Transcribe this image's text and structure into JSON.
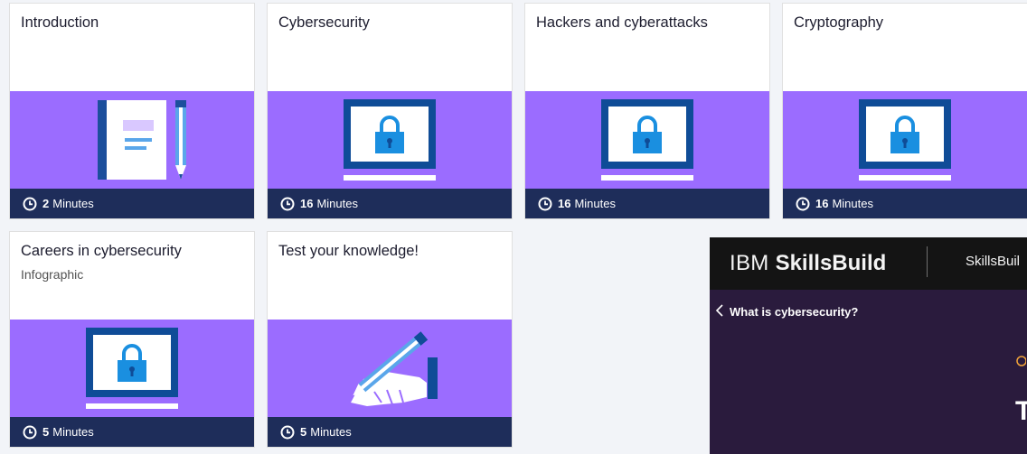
{
  "cards": [
    {
      "title": "Introduction",
      "subtitle": "",
      "duration": "2",
      "unit": "Minutes",
      "art": "notebook-illustration"
    },
    {
      "title": "Cybersecurity",
      "subtitle": "",
      "duration": "16",
      "unit": "Minutes",
      "art": "laptop-lock-illustration"
    },
    {
      "title": "Hackers and cyberattacks",
      "subtitle": "",
      "duration": "16",
      "unit": "Minutes",
      "art": "laptop-lock-illustration"
    },
    {
      "title": "Cryptography",
      "subtitle": "",
      "duration": "16",
      "unit": "Minutes",
      "art": "laptop-lock-illustration"
    },
    {
      "title": "Careers in cybersecurity",
      "subtitle": "Infographic",
      "duration": "5",
      "unit": "Minutes",
      "art": "laptop-lock-illustration"
    },
    {
      "title": "Test your knowledge!",
      "subtitle": "",
      "duration": "5",
      "unit": "Minutes",
      "art": "hand-pencil-illustration"
    }
  ],
  "promo": {
    "logo_light": "IBM",
    "logo_bold": "SkillsBuild",
    "nav_text": "SkillsBuil",
    "back_link": "What is cybersecurity?",
    "big_text": "T"
  },
  "colors": {
    "art_bg": "#9b6cff",
    "footer_bg": "#1e2d5a",
    "device_blue": "#0f62a8",
    "lock_blue": "#1a8fe0"
  }
}
